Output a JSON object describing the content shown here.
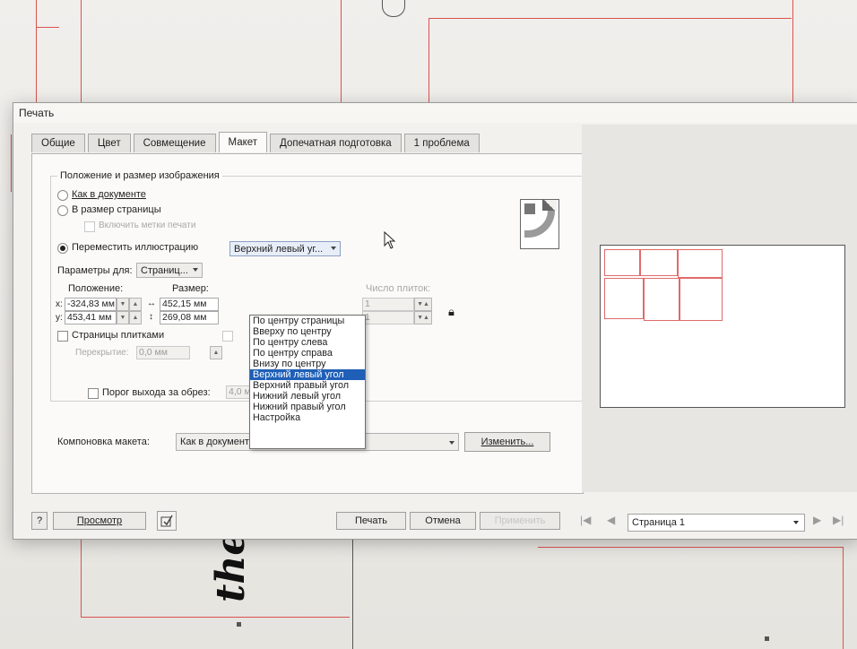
{
  "dialog": {
    "title": "Печать",
    "tabs": [
      {
        "label": "Общие"
      },
      {
        "label": "Цвет"
      },
      {
        "label": "Совмещение"
      },
      {
        "label": "Макет"
      },
      {
        "label": "Допечатная подготовка"
      },
      {
        "label": "1 проблема"
      }
    ],
    "active_tab": "Макет"
  },
  "layout_tab": {
    "group_title": "Положение и размер изображения",
    "opt_as_document": "Как в документе",
    "opt_page_size": "В размер страницы",
    "chk_print_marks": "Включить метки печати",
    "opt_move_illustration": "Переместить иллюстрацию",
    "position_combo_value": "Верхний левый уг...",
    "params_for_label": "Параметры для:",
    "params_for_value": "Страниц...",
    "position_label": "Положение:",
    "size_label": "Размер:",
    "x_label": "x:",
    "x_value": "-324,83 мм",
    "y_label": "y:",
    "y_value": "453,41 мм",
    "width_value": "452,15 мм",
    "height_value": "269,08 мм",
    "tile_count_label": "Число плиток:",
    "tiles_x_value": "1",
    "tiles_y_value": "1",
    "tile_pages_label": "Страницы плитками",
    "overlap_label": "Перекрытие:",
    "overlap_value": "0,0 мм",
    "bleed_label": "Порог выхода за обрез:",
    "bleed_value": "4,0 мм",
    "imposition_label": "Компоновка макета:",
    "imposition_value": "Как в документе (Вся страница)",
    "change_button": "Изменить..."
  },
  "dropdown": {
    "items": [
      "По центру страницы",
      "Вверху по центру",
      "По центру слева",
      "По центру справа",
      "Внизу по центру",
      "Верхний левый угол",
      "Верхний правый угол",
      "Нижний левый угол",
      "Нижний правый угол",
      "Настройка"
    ],
    "selected_index": 5
  },
  "footer": {
    "help": "?",
    "preview": "Просмотр",
    "print": "Печать",
    "cancel": "Отмена",
    "apply": "Применить",
    "page_select": "Страница 1"
  },
  "colors": {
    "accent": "#1f5fb8",
    "cut_lines": "#d9534f"
  }
}
